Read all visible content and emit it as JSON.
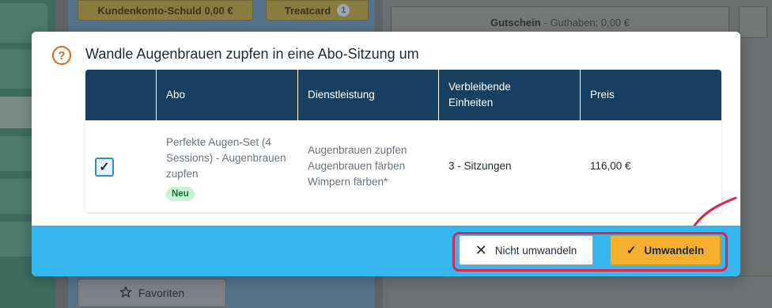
{
  "background": {
    "kundenkonto_label": "Kundenkonto-Schuld 0,00 €",
    "treatcard_label": "Treatcard",
    "treatcard_count": "1",
    "gutschein_label": "Gutschein",
    "gutschein_sub": "- Guthaben: 0,00 €",
    "favoriten_label": "Favoriten"
  },
  "modal": {
    "title": "Wandle Augenbrauen zupfen in eine Abo-Sitzung um",
    "question_icon": "question-circle-icon",
    "table": {
      "headers": [
        "",
        "Abo",
        "Dienstleistung",
        "Verbleibende Einheiten",
        "Preis"
      ],
      "rows": [
        {
          "checked": true,
          "abo": "Perfekte Augen-Set (4 Sessions) - Augenbrauen zupfen",
          "badge": "Neu",
          "dienstleistung": [
            "Augenbrauen zupfen",
            "Augenbrauen färben",
            "Wimpern färben*"
          ],
          "einheiten": "3 - Sitzungen",
          "preis": "116,00 €"
        }
      ]
    },
    "buttons": {
      "cancel_label": "Nicht umwandeln",
      "confirm_label": "Umwandeln"
    }
  },
  "colors": {
    "header_bg": "#173f5f",
    "footer_bg": "#34b6f0",
    "confirm_bg": "#f5b02e",
    "highlight": "#e0234a",
    "icon_orange": "#d46a1e"
  }
}
